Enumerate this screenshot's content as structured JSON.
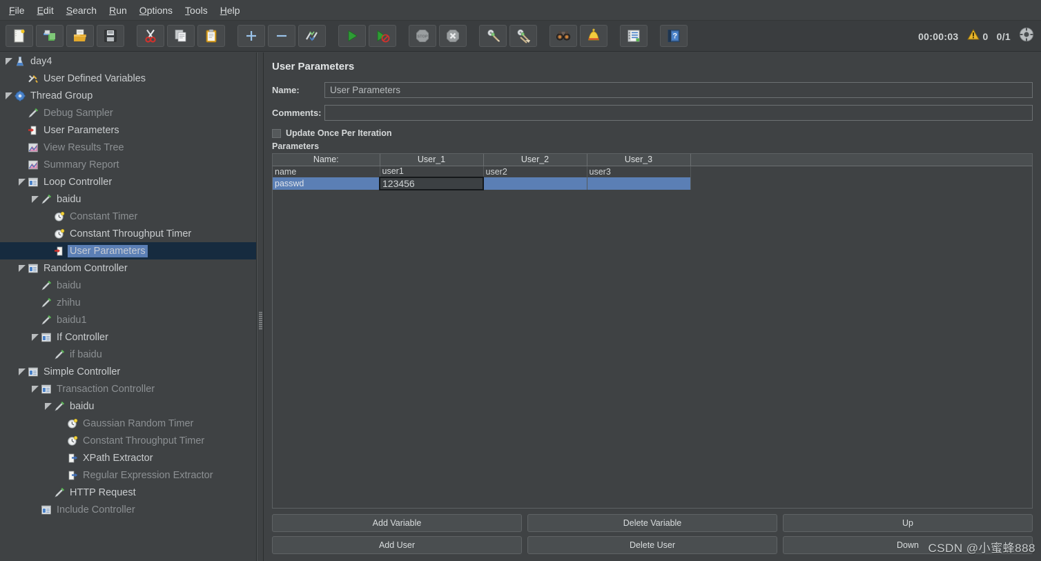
{
  "app": {
    "title": "Apache JMeter - User Parameters",
    "accent": "#5b7fb5",
    "bg": "#3f4244"
  },
  "menubar": [
    {
      "label": "File",
      "mnemonic": "F"
    },
    {
      "label": "Edit",
      "mnemonic": "E"
    },
    {
      "label": "Search",
      "mnemonic": "S"
    },
    {
      "label": "Run",
      "mnemonic": "R"
    },
    {
      "label": "Options",
      "mnemonic": "O"
    },
    {
      "label": "Tools",
      "mnemonic": "T"
    },
    {
      "label": "Help",
      "mnemonic": "H"
    }
  ],
  "toolbar": {
    "buttons": [
      {
        "icon": "new-file-icon",
        "tip": "New"
      },
      {
        "icon": "templates-icon",
        "tip": "Templates"
      },
      {
        "icon": "open-folder-icon",
        "tip": "Open"
      },
      {
        "icon": "save-floppy-icon",
        "tip": "Save"
      },
      {
        "icon": "cut-scissors-icon",
        "tip": "Cut"
      },
      {
        "icon": "copy-documents-icon",
        "tip": "Copy"
      },
      {
        "icon": "paste-clipboard-icon",
        "tip": "Paste"
      },
      {
        "icon": "plus-icon",
        "tip": "Expand All"
      },
      {
        "icon": "minus-icon",
        "tip": "Collapse All"
      },
      {
        "icon": "toggle-icon",
        "tip": "Toggle"
      },
      {
        "icon": "play-icon",
        "tip": "Start"
      },
      {
        "icon": "play-no-timers-icon",
        "tip": "Start no pauses"
      },
      {
        "icon": "stop-icon",
        "tip": "Stop"
      },
      {
        "icon": "shutdown-icon",
        "tip": "Shutdown"
      },
      {
        "icon": "clear-icon",
        "tip": "Clear"
      },
      {
        "icon": "clear-all-icon",
        "tip": "Clear All"
      },
      {
        "icon": "search-binoculars-icon",
        "tip": "Search"
      },
      {
        "icon": "function-helper-icon",
        "tip": "Function Helper Dialog"
      },
      {
        "icon": "templates-list-icon",
        "tip": "Templates"
      },
      {
        "icon": "help-book-icon",
        "tip": "Help"
      }
    ],
    "status": {
      "elapsed": "00:00:03",
      "warning_icon": "warning-triangle-icon",
      "warning_count": "0",
      "threads": "0/1",
      "thread_state_icon": "thread-state-icon"
    }
  },
  "tree": {
    "items": [
      {
        "label": "day4",
        "indent": 0,
        "twisty": "open",
        "icon": "test-plan-icon",
        "dim": false,
        "selected": false
      },
      {
        "label": "User Defined Variables",
        "indent": 1,
        "twisty": "none",
        "icon": "config-element-icon",
        "dim": false,
        "selected": false
      },
      {
        "label": "Thread Group",
        "indent": 0,
        "twisty": "open",
        "icon": "thread-group-icon",
        "dim": false,
        "selected": false
      },
      {
        "label": "Debug Sampler",
        "indent": 1,
        "twisty": "none",
        "icon": "sampler-icon",
        "dim": true,
        "selected": false
      },
      {
        "label": "User Parameters",
        "indent": 1,
        "twisty": "none",
        "icon": "pre-processor-icon",
        "dim": false,
        "selected": false
      },
      {
        "label": "View Results Tree",
        "indent": 1,
        "twisty": "none",
        "icon": "listener-icon",
        "dim": true,
        "selected": false
      },
      {
        "label": "Summary Report",
        "indent": 1,
        "twisty": "none",
        "icon": "listener-icon",
        "dim": true,
        "selected": false
      },
      {
        "label": "Loop Controller",
        "indent": 1,
        "twisty": "open",
        "icon": "controller-icon",
        "dim": false,
        "selected": false
      },
      {
        "label": "baidu",
        "indent": 2,
        "twisty": "open",
        "icon": "sampler-icon",
        "dim": false,
        "selected": false
      },
      {
        "label": "Constant Timer",
        "indent": 3,
        "twisty": "none",
        "icon": "timer-icon",
        "dim": true,
        "selected": false
      },
      {
        "label": "Constant Throughput Timer",
        "indent": 3,
        "twisty": "none",
        "icon": "timer-icon",
        "dim": false,
        "selected": false
      },
      {
        "label": "User Parameters",
        "indent": 3,
        "twisty": "none",
        "icon": "pre-processor-icon",
        "dim": false,
        "selected": true
      },
      {
        "label": "Random Controller",
        "indent": 1,
        "twisty": "open",
        "icon": "controller-icon",
        "dim": false,
        "selected": false
      },
      {
        "label": "baidu",
        "indent": 2,
        "twisty": "none",
        "icon": "sampler-icon",
        "dim": true,
        "selected": false
      },
      {
        "label": "zhihu",
        "indent": 2,
        "twisty": "none",
        "icon": "sampler-icon",
        "dim": true,
        "selected": false
      },
      {
        "label": "baidu1",
        "indent": 2,
        "twisty": "none",
        "icon": "sampler-icon",
        "dim": true,
        "selected": false
      },
      {
        "label": "If Controller",
        "indent": 2,
        "twisty": "open",
        "icon": "controller-icon",
        "dim": false,
        "selected": false
      },
      {
        "label": "if baidu",
        "indent": 3,
        "twisty": "none",
        "icon": "sampler-icon",
        "dim": true,
        "selected": false
      },
      {
        "label": "Simple Controller",
        "indent": 1,
        "twisty": "open",
        "icon": "controller-icon",
        "dim": false,
        "selected": false
      },
      {
        "label": "Transaction Controller",
        "indent": 2,
        "twisty": "open",
        "icon": "controller-icon",
        "dim": true,
        "selected": false
      },
      {
        "label": "baidu",
        "indent": 3,
        "twisty": "open",
        "icon": "sampler-icon",
        "dim": false,
        "selected": false
      },
      {
        "label": "Gaussian Random Timer",
        "indent": 4,
        "twisty": "none",
        "icon": "timer-icon",
        "dim": true,
        "selected": false
      },
      {
        "label": "Constant Throughput Timer",
        "indent": 4,
        "twisty": "none",
        "icon": "timer-icon",
        "dim": true,
        "selected": false
      },
      {
        "label": "XPath Extractor",
        "indent": 4,
        "twisty": "none",
        "icon": "post-processor-icon",
        "dim": false,
        "selected": false
      },
      {
        "label": "Regular Expression Extractor",
        "indent": 4,
        "twisty": "none",
        "icon": "post-processor-icon",
        "dim": true,
        "selected": false
      },
      {
        "label": "HTTP Request",
        "indent": 3,
        "twisty": "none",
        "icon": "sampler-icon",
        "dim": false,
        "selected": false
      },
      {
        "label": "Include Controller",
        "indent": 2,
        "twisty": "none",
        "icon": "controller-icon",
        "dim": true,
        "selected": false
      }
    ]
  },
  "panel": {
    "title": "User Parameters",
    "name_label": "Name:",
    "name_value": "User Parameters",
    "name_placeholder": "",
    "comments_label": "Comments:",
    "comments_value": "",
    "comments_placeholder": "",
    "update_once_label": "Update Once Per Iteration",
    "update_once_checked": false,
    "parameters_label": "Parameters",
    "table": {
      "columns": [
        "Name:",
        "User_1",
        "User_2",
        "User_3"
      ],
      "rows": [
        {
          "cells": [
            "name",
            "user1",
            "user2",
            "user3"
          ],
          "selected": false,
          "editing_col": -1
        },
        {
          "cells": [
            "passwd",
            "123456",
            "",
            ""
          ],
          "selected": true,
          "editing_col": 1
        }
      ]
    },
    "buttons": [
      {
        "label": "Add Variable",
        "name": "add-variable-button"
      },
      {
        "label": "Delete Variable",
        "name": "delete-variable-button"
      },
      {
        "label": "Up",
        "name": "move-up-button"
      },
      {
        "label": "Add User",
        "name": "add-user-button"
      },
      {
        "label": "Delete User",
        "name": "delete-user-button"
      },
      {
        "label": "Down",
        "name": "move-down-button"
      }
    ]
  },
  "watermark": {
    "text": "CSDN @小蜜蜂888"
  }
}
